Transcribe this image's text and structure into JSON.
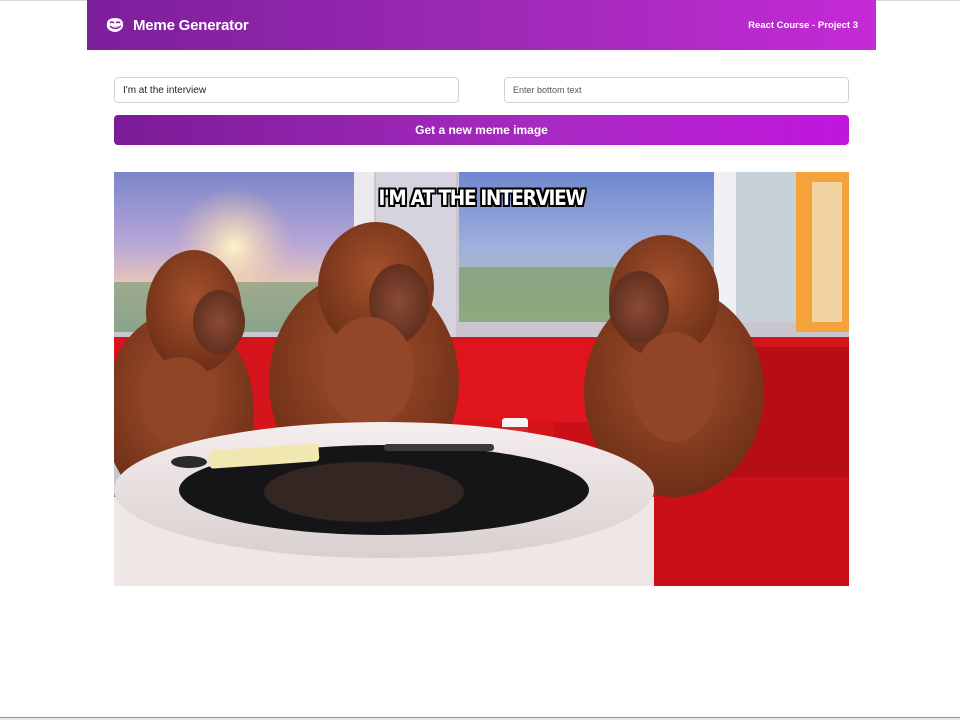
{
  "header": {
    "brand_title": "Meme Generator",
    "course_label": "React Course - Project 3",
    "logo_icon": "troll-face-icon"
  },
  "form": {
    "top_text_value": "I'm at the interview",
    "bottom_text_placeholder": "Enter bottom text",
    "bottom_text_value": "",
    "button_label": "Get a new meme image"
  },
  "meme": {
    "top_caption": "I'M AT THE INTERVIEW",
    "bottom_caption": ""
  },
  "colors": {
    "header_gradient_start": "#7c1f9b",
    "header_gradient_end": "#c42ad6",
    "button_gradient_start": "#7b1c96",
    "button_gradient_end": "#c116de"
  }
}
